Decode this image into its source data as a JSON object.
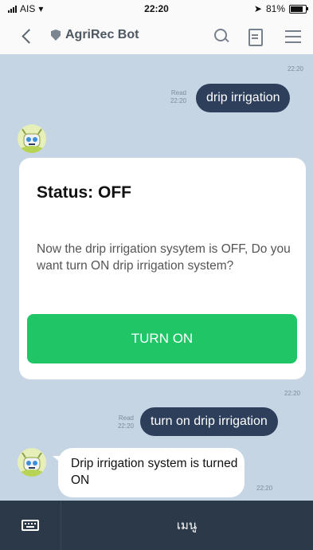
{
  "status_bar": {
    "carrier": "AIS",
    "time": "22:20",
    "battery": "81%"
  },
  "header": {
    "title": "AgriRec Bot"
  },
  "messages": {
    "ts_top": "22:20",
    "out1": {
      "text": "drip irrigation",
      "read": "Read",
      "time": "22:20"
    },
    "card": {
      "title": "Status: OFF",
      "body": "Now the drip irrigation sysytem is OFF, Do you want turn ON drip irrigation system?",
      "button": "TURN ON"
    },
    "ts_mid": "22:20",
    "out2": {
      "text": "turn on drip irrigation",
      "read": "Read",
      "time": "22:20"
    },
    "in1": {
      "text": "Drip irrigation system is turned ON",
      "time": "22:20"
    }
  },
  "bottom_bar": {
    "menu_label": "เมนู"
  }
}
